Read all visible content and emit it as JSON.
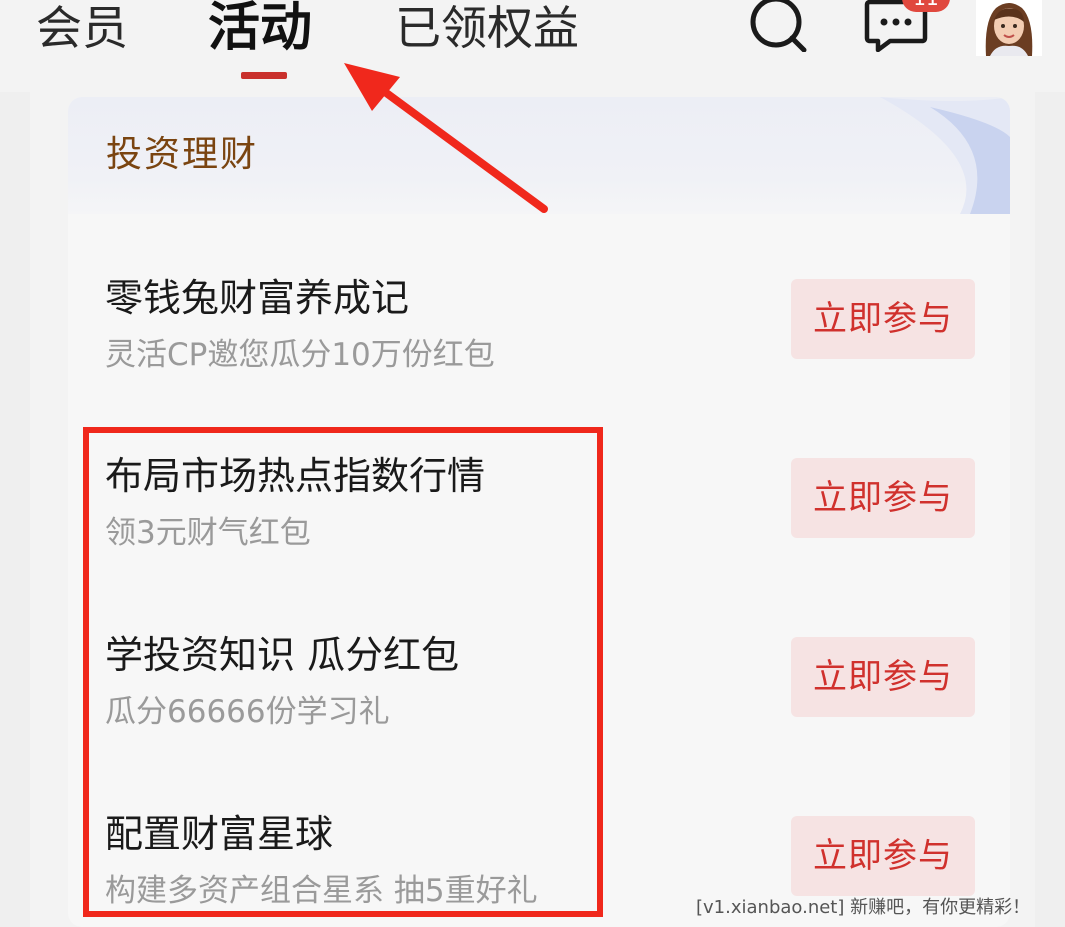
{
  "nav": {
    "tabs": [
      {
        "label": "会员"
      },
      {
        "label": "活动"
      },
      {
        "label": "已领权益"
      }
    ],
    "active_tab": "活动",
    "message_badge": "11",
    "icons": [
      "search-icon",
      "message-icon",
      "avatar"
    ]
  },
  "section": {
    "title": "投资理财"
  },
  "items": [
    {
      "title": "零钱兔财富养成记",
      "subtitle": "灵活CP邀您瓜分10万份红包",
      "button": "立即参与"
    },
    {
      "title": "布局市场热点指数行情",
      "subtitle": "领3元财气红包",
      "button": "立即参与"
    },
    {
      "title": "学投资知识 瓜分红包",
      "subtitle": "瓜分66666份学习礼",
      "button": "立即参与"
    },
    {
      "title": "配置财富星球",
      "subtitle": "构建多资产组合星系 抽5重好礼",
      "button": "立即参与"
    }
  ],
  "watermark": "[v1.xianbao.net] 新赚吧，有你更精彩！",
  "colors": {
    "accent_red": "#d0312d",
    "button_bg": "#f6e3e3",
    "section_title": "#7a4410",
    "annotation_red": "#f0281c"
  }
}
